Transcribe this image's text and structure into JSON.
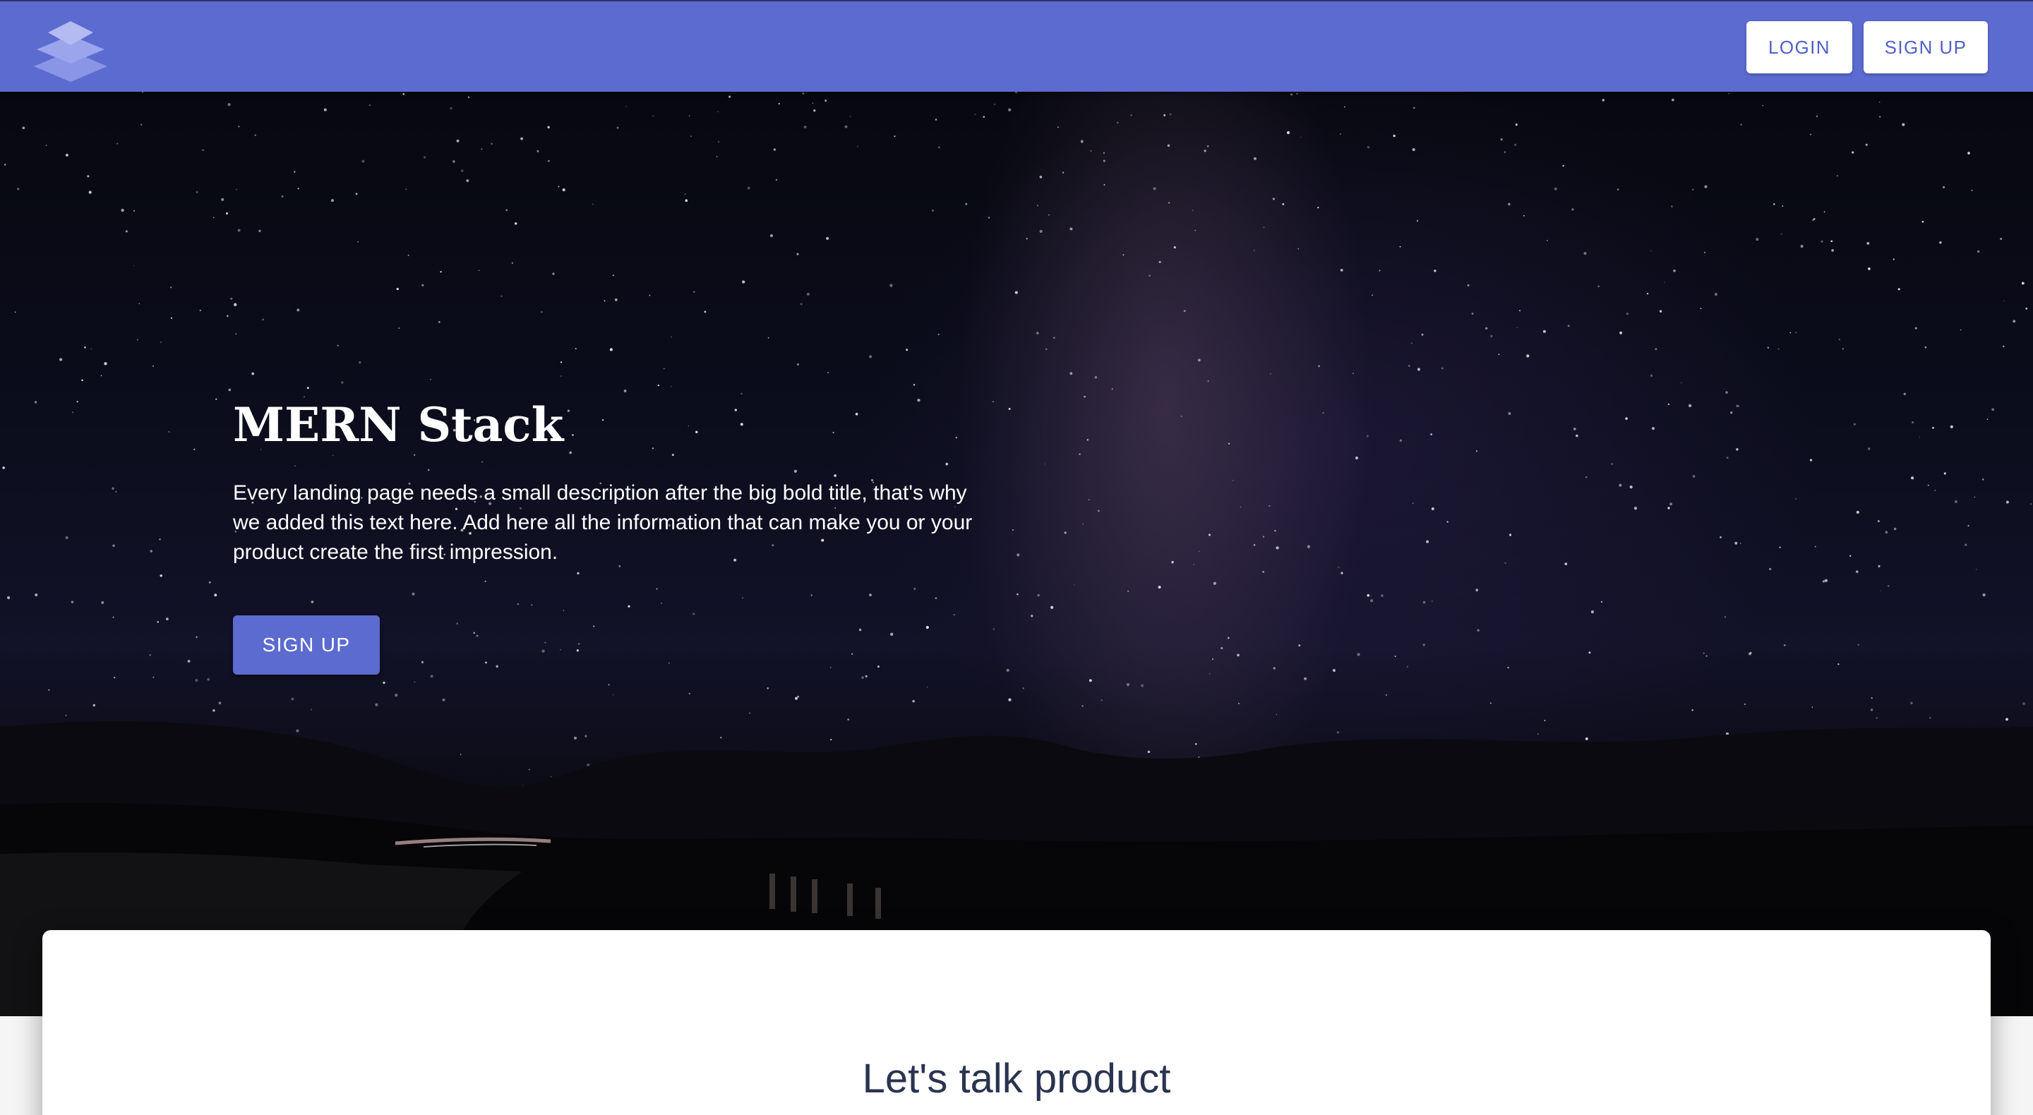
{
  "header": {
    "logo_icon": "layers-icon",
    "login_label": "LOGIN",
    "signup_label": "SIGN UP"
  },
  "hero": {
    "title": "MERN Stack",
    "description": "Every landing page needs a small description after the big bold title, that's why we added this text here. Add here all the information that can make you or your product create the first impression.",
    "cta_label": "SIGN UP"
  },
  "section": {
    "title": "Let's talk product"
  },
  "colors": {
    "primary": "#5c6bd0",
    "button_text": "#5060c8",
    "heading_dark": "#2a3450",
    "hero_text": "#ffffff"
  }
}
